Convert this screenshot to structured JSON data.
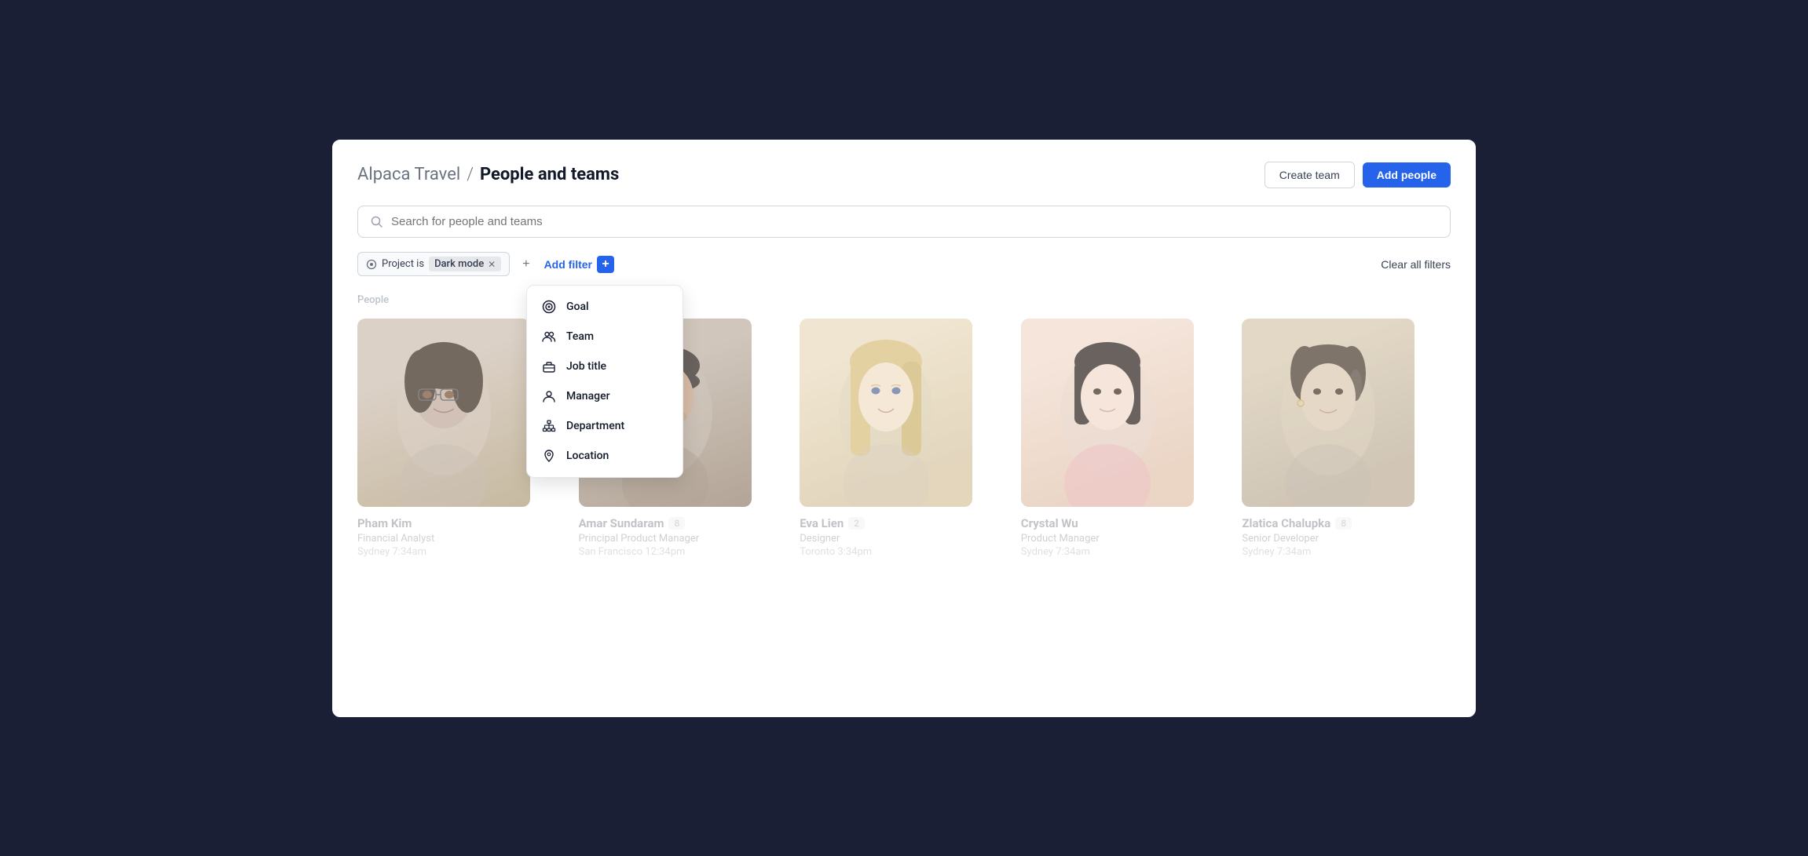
{
  "app": {
    "name": "Alpaca Travel",
    "separator": "/",
    "page_title": "People and teams"
  },
  "header": {
    "create_team_label": "Create team",
    "add_people_label": "Add people"
  },
  "search": {
    "placeholder": "Search for people and teams"
  },
  "filters": {
    "filter_label": "Project is",
    "filter_value": "Dark mode",
    "add_filter_label": "Add filter",
    "clear_label": "Clear all filters"
  },
  "dropdown": {
    "items": [
      {
        "id": "goal",
        "label": "Goal",
        "icon": "goal"
      },
      {
        "id": "team",
        "label": "Team",
        "icon": "team"
      },
      {
        "id": "job-title",
        "label": "Job title",
        "icon": "briefcase"
      },
      {
        "id": "manager",
        "label": "Manager",
        "icon": "person"
      },
      {
        "id": "department",
        "label": "Department",
        "icon": "hierarchy"
      },
      {
        "id": "location",
        "label": "Location",
        "icon": "location"
      }
    ]
  },
  "people_section": {
    "label": "People"
  },
  "people": [
    {
      "id": "pham-kim",
      "name": "Pham Kim",
      "badge": "",
      "role": "Financial Analyst",
      "location": "Sydney",
      "time": "7:34am"
    },
    {
      "id": "amar-sundaram",
      "name": "Amar Sundaram",
      "badge": "8",
      "role": "Principal Product Manager",
      "location": "San Francisco",
      "time": "12:34pm"
    },
    {
      "id": "eva-lien",
      "name": "Eva Lien",
      "badge": "2",
      "role": "Designer",
      "location": "Toronto",
      "time": "3:34pm"
    },
    {
      "id": "crystal-wu",
      "name": "Crystal Wu",
      "badge": "",
      "role": "Product Manager",
      "location": "Sydney",
      "time": "7:34am"
    },
    {
      "id": "zlatica-chalupka",
      "name": "Zlatica Chalupka",
      "badge": "8",
      "role": "Senior Developer",
      "location": "Sydney",
      "time": "7:34am"
    }
  ]
}
